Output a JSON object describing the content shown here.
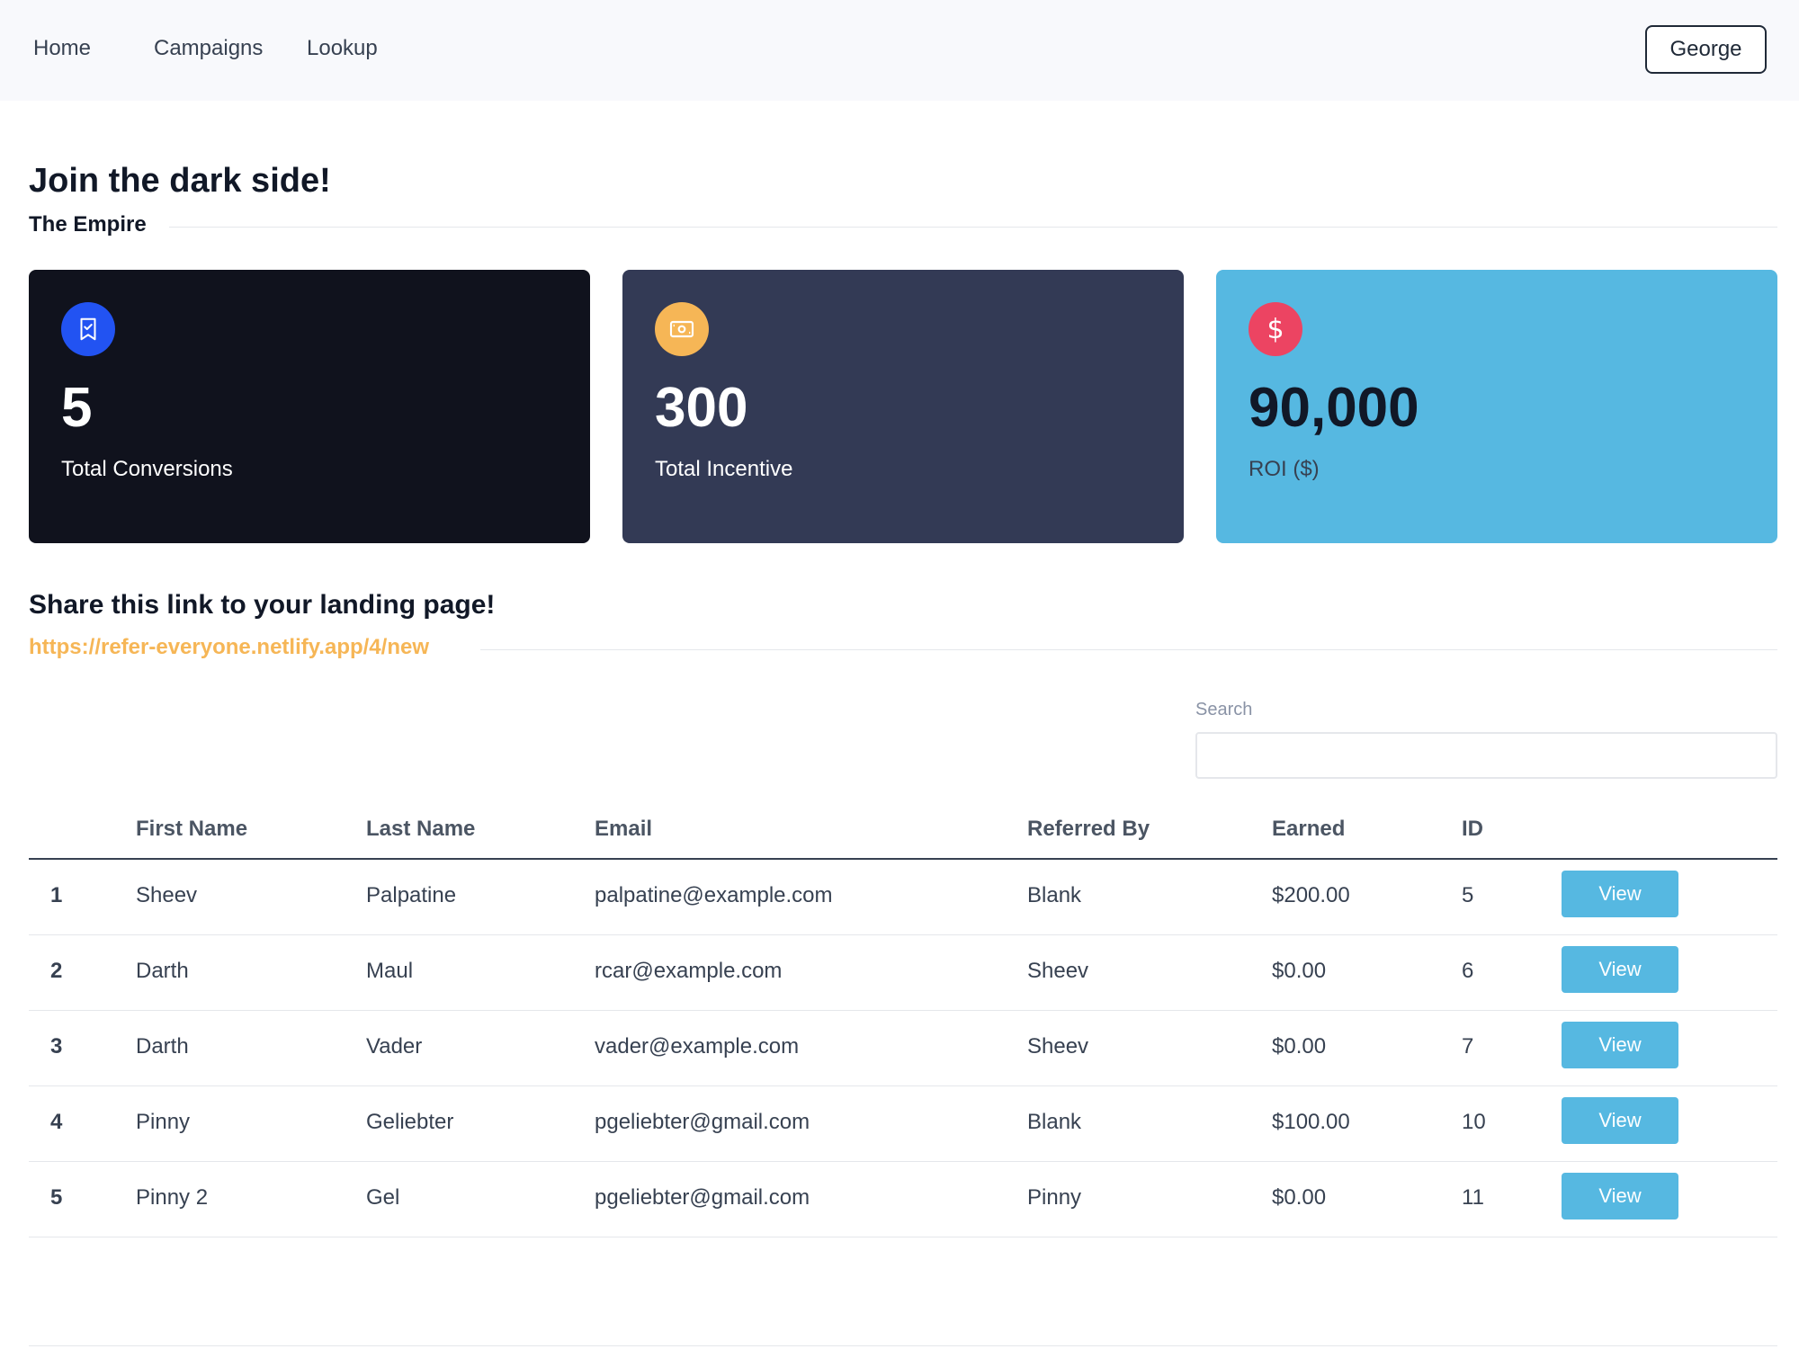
{
  "nav": {
    "links": [
      "Home",
      "Campaigns",
      "Lookup"
    ],
    "user_button": "George"
  },
  "campaign": {
    "title": "Join the dark side!",
    "organization": "The Empire"
  },
  "stats": [
    {
      "value": "5",
      "label": "Total Conversions",
      "icon": "bookmark-check-icon",
      "bg_color": "#10121d",
      "icon_color": "#2253f2"
    },
    {
      "value": "300",
      "label": "Total Incentive",
      "icon": "banknote-icon",
      "bg_color": "#333a55",
      "icon_color": "#f6b656"
    },
    {
      "value": "90,000",
      "label": "ROI ($)",
      "icon": "dollar-icon",
      "bg_color": "#56b8e1",
      "icon_color": "#ec4462"
    }
  ],
  "share": {
    "title": "Share this link to your landing page!",
    "link": "https://refer-everyone.netlify.app/4/new"
  },
  "search": {
    "label": "Search",
    "value": ""
  },
  "table": {
    "columns": [
      "",
      "First Name",
      "Last Name",
      "Email",
      "Referred By",
      "Earned",
      "ID",
      ""
    ],
    "rows": [
      {
        "index": "1",
        "first_name": "Sheev",
        "last_name": "Palpatine",
        "email": "palpatine@example.com",
        "referred_by": "Blank",
        "earned": "$200.00",
        "id": "5",
        "action": "View"
      },
      {
        "index": "2",
        "first_name": "Darth",
        "last_name": "Maul",
        "email": "rcar@example.com",
        "referred_by": "Sheev",
        "earned": "$0.00",
        "id": "6",
        "action": "View"
      },
      {
        "index": "3",
        "first_name": "Darth",
        "last_name": "Vader",
        "email": "vader@example.com",
        "referred_by": "Sheev",
        "earned": "$0.00",
        "id": "7",
        "action": "View"
      },
      {
        "index": "4",
        "first_name": "Pinny",
        "last_name": "Geliebter",
        "email": "pgeliebter@gmail.com",
        "referred_by": "Blank",
        "earned": "$100.00",
        "id": "10",
        "action": "View"
      },
      {
        "index": "5",
        "first_name": "Pinny 2",
        "last_name": "Gel",
        "email": "pgeliebter@gmail.com",
        "referred_by": "Pinny",
        "earned": "$0.00",
        "id": "11",
        "action": "View"
      }
    ]
  },
  "colors": {
    "accent_link": "#f6b656",
    "view_button": "#56b8e1"
  }
}
